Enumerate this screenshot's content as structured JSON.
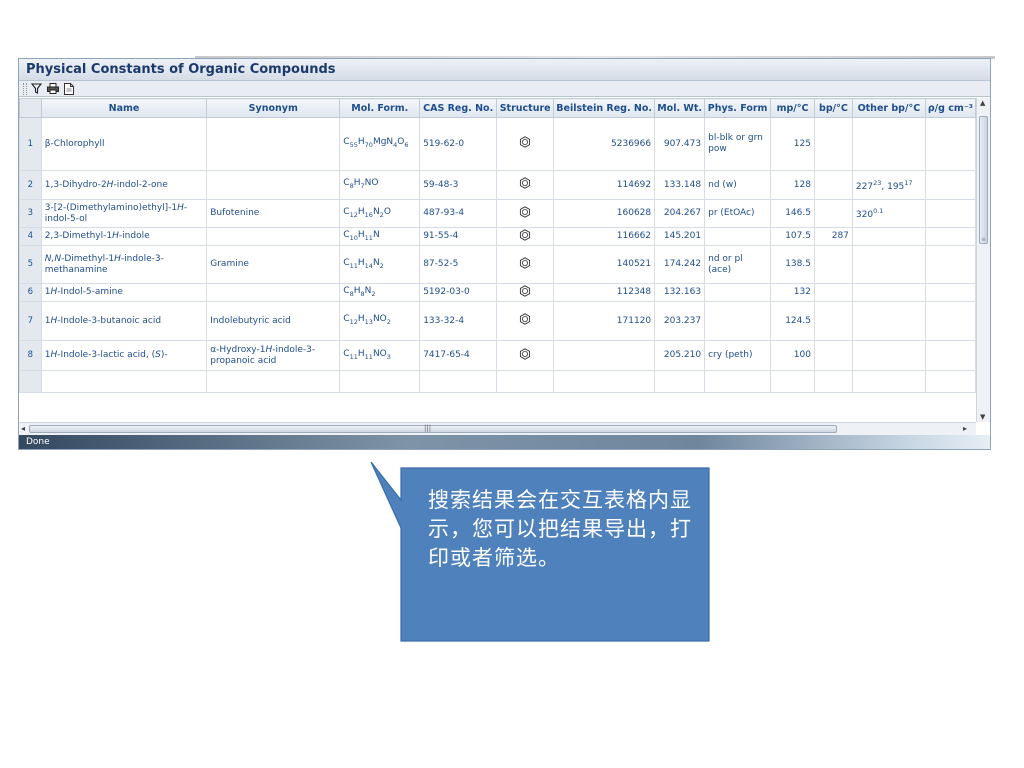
{
  "window": {
    "title": "Physical Constants of Organic Compounds",
    "status": "Done"
  },
  "toolbar": {
    "icons": [
      "filter-icon",
      "print-icon",
      "document-icon"
    ]
  },
  "table": {
    "columns": [
      "",
      "Name",
      "Synonym",
      "Mol. Form.",
      "CAS Reg. No.",
      "Structure",
      "Beilstein Reg. No.",
      "Mol. Wt.",
      "Phys. Form",
      "mp/°C",
      "bp/°C",
      "Other bp/°C",
      "ρ/g cm⁻³"
    ],
    "rows": [
      {
        "n": "1",
        "name": "β-Chlorophyll",
        "synonym": "",
        "formula": "C<sub>55</sub>H<sub>70</sub>MgN<sub>4</sub>O<sub>6</sub>",
        "cas": "519-62-0",
        "beilstein": "5236966",
        "mw": "907.473",
        "phys": "bl-blk or grn pow",
        "mp": "125",
        "bp": "",
        "other": ""
      },
      {
        "n": "2",
        "name": "1,3-Dihydro-2<i>H</i>-indol-2-one",
        "synonym": "",
        "formula": "C<sub>8</sub>H<sub>7</sub>NO",
        "cas": "59-48-3",
        "beilstein": "114692",
        "mw": "133.148",
        "phys": "nd (w)",
        "mp": "128",
        "bp": "",
        "other": "227<sup>23</sup>, 195<sup>17</sup>"
      },
      {
        "n": "3",
        "name": "3-[2-(Dimethylamino)ethyl]-1<i>H</i>-indol-5-ol",
        "synonym": "Bufotenine",
        "formula": "C<sub>12</sub>H<sub>16</sub>N<sub>2</sub>O",
        "cas": "487-93-4",
        "beilstein": "160628",
        "mw": "204.267",
        "phys": "pr (EtOAc)",
        "mp": "146.5",
        "bp": "",
        "other": "320<sup>0.1</sup>"
      },
      {
        "n": "4",
        "name": "2,3-Dimethyl-1<i>H</i>-indole",
        "synonym": "",
        "formula": "C<sub>10</sub>H<sub>11</sub>N",
        "cas": "91-55-4",
        "beilstein": "116662",
        "mw": "145.201",
        "phys": "",
        "mp": "107.5",
        "bp": "287",
        "other": ""
      },
      {
        "n": "5",
        "name": "<i>N,N</i>-Dimethyl-1<i>H</i>-indole-3-methanamine",
        "synonym": "Gramine",
        "formula": "C<sub>11</sub>H<sub>14</sub>N<sub>2</sub>",
        "cas": "87-52-5",
        "beilstein": "140521",
        "mw": "174.242",
        "phys": "nd or pl (ace)",
        "mp": "138.5",
        "bp": "",
        "other": ""
      },
      {
        "n": "6",
        "name": "1<i>H</i>-Indol-5-amine",
        "synonym": "",
        "formula": "C<sub>8</sub>H<sub>8</sub>N<sub>2</sub>",
        "cas": "5192-03-0",
        "beilstein": "112348",
        "mw": "132.163",
        "phys": "",
        "mp": "132",
        "bp": "",
        "other": ""
      },
      {
        "n": "7",
        "name": "1<i>H</i>-Indole-3-butanoic acid",
        "synonym": "Indolebutyric acid",
        "formula": "C<sub>12</sub>H<sub>13</sub>NO<sub>2</sub>",
        "cas": "133-32-4",
        "beilstein": "171120",
        "mw": "203.237",
        "phys": "",
        "mp": "124.5",
        "bp": "",
        "other": ""
      },
      {
        "n": "8",
        "name": "1<i>H</i>-Indole-3-lactic acid, (<i>S</i>)-",
        "synonym": "α-Hydroxy-1<i>H</i>-indole-3-propanoic acid",
        "formula": "C<sub>11</sub>H<sub>11</sub>NO<sub>3</sub>",
        "cas": "7417-65-4",
        "beilstein": "",
        "mw": "205.210",
        "phys": "cry (peth)",
        "mp": "100",
        "bp": "",
        "other": ""
      }
    ],
    "structure_icon": "structure-icon"
  },
  "callout": {
    "text": "搜索结果会在交互表格内显示，您可以把结果导出，打印或者筛选。",
    "color": "#4f81bd"
  }
}
